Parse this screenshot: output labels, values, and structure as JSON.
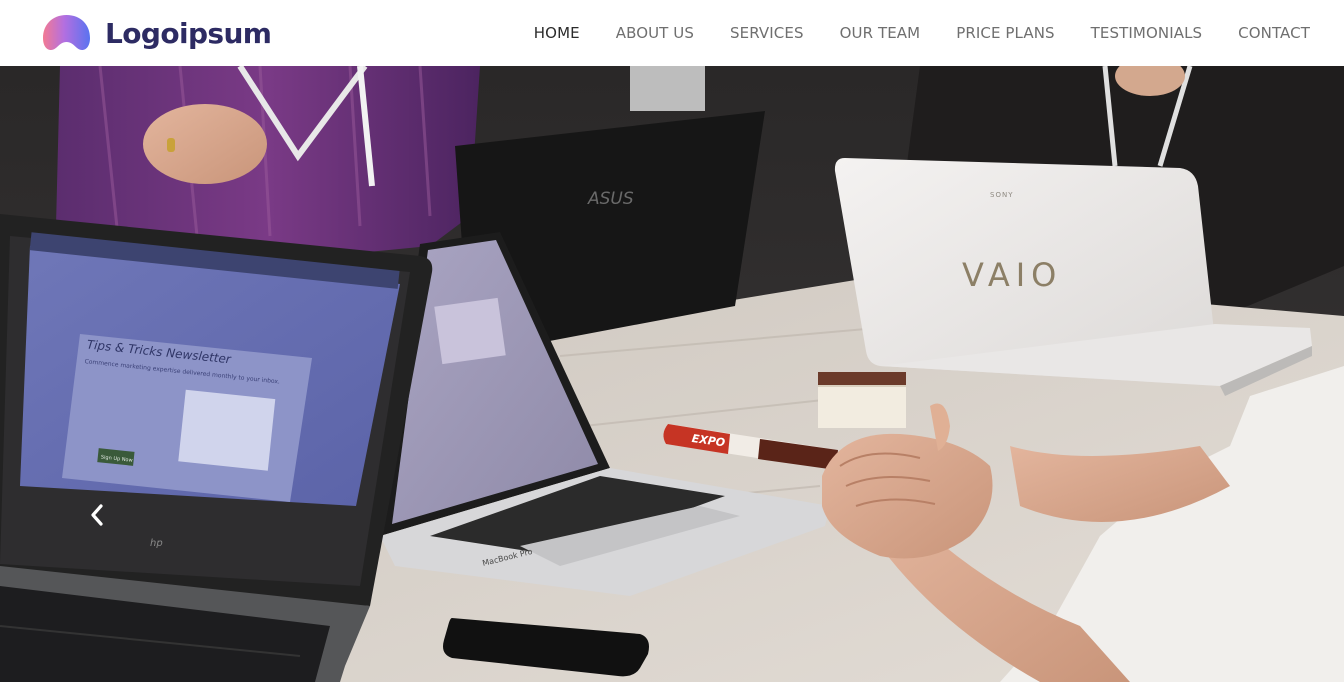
{
  "brand": {
    "name": "Logoipsum"
  },
  "nav": {
    "items": [
      {
        "label": "HOME",
        "active": true
      },
      {
        "label": "ABOUT US",
        "active": false
      },
      {
        "label": "SERVICES",
        "active": false
      },
      {
        "label": "OUR TEAM",
        "active": false
      },
      {
        "label": "PRICE PLANS",
        "active": false
      },
      {
        "label": "TESTIMONIALS",
        "active": false
      },
      {
        "label": "CONTACT",
        "active": false
      }
    ]
  },
  "hero": {
    "image": "office-meeting-laptops-photo",
    "screen_text": {
      "newsletter_title": "Tips & Tricks Newsletter",
      "newsletter_subtitle": "Commence marketing expertise delivered monthly to your inbox.",
      "signup_button": "Sign Up Now",
      "laptop_hp": "hp",
      "laptop_asus": "ASUS",
      "laptop_macbook": "MacBook Pro",
      "laptop_vaio": "VAIO",
      "laptop_sony": "SONY",
      "marker": "EXPO"
    },
    "carousel_prev_icon": "chevron-left-icon"
  },
  "colors": {
    "brand_text": "#2d2b63",
    "nav_text": "#6f6f6f",
    "nav_active": "#2b2b2b",
    "logo_gradient_start": "#f07a9a",
    "logo_gradient_end": "#6a5cf0"
  }
}
